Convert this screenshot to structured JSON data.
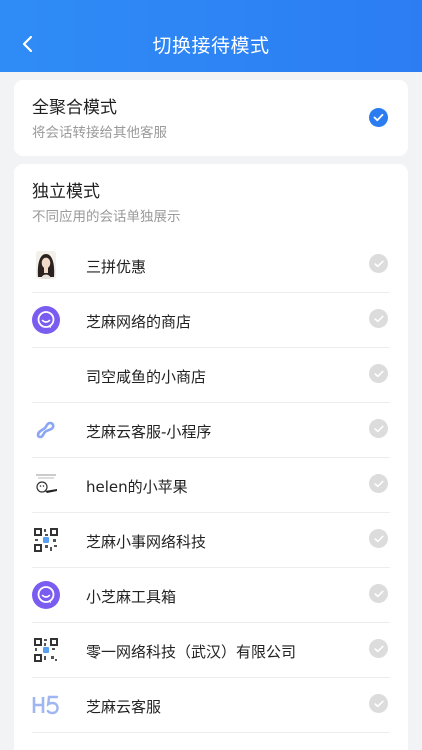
{
  "header": {
    "title": "切换接待模式"
  },
  "aggregate_mode": {
    "title": "全聚合模式",
    "subtitle": "将会话转接给其他客服",
    "selected": true
  },
  "independent_mode": {
    "title": "独立模式",
    "subtitle": "不同应用的会话单独展示",
    "apps": [
      {
        "name": "三拼优惠",
        "avatar": "portrait-avatar"
      },
      {
        "name": "芝麻网络的商店",
        "avatar": "chat-logo-avatar"
      },
      {
        "name": "司空咸鱼的小商店",
        "avatar": "blank-avatar"
      },
      {
        "name": "芝麻云客服-小程序",
        "avatar": "mini-program-icon"
      },
      {
        "name": "helen的小苹果",
        "avatar": "sticker-avatar"
      },
      {
        "name": "芝麻小事网络科技",
        "avatar": "qr-code-avatar"
      },
      {
        "name": "小芝麻工具箱",
        "avatar": "chat-logo-avatar"
      },
      {
        "name": "零一网络科技（武汉）有限公司",
        "avatar": "qr-code-avatar"
      },
      {
        "name": "芝麻云客服",
        "avatar": "h5-icon"
      }
    ]
  },
  "colors": {
    "primary": "#2c7cf1",
    "logo_purple": "#7b5cf0",
    "check_off": "#dcdcdc"
  }
}
